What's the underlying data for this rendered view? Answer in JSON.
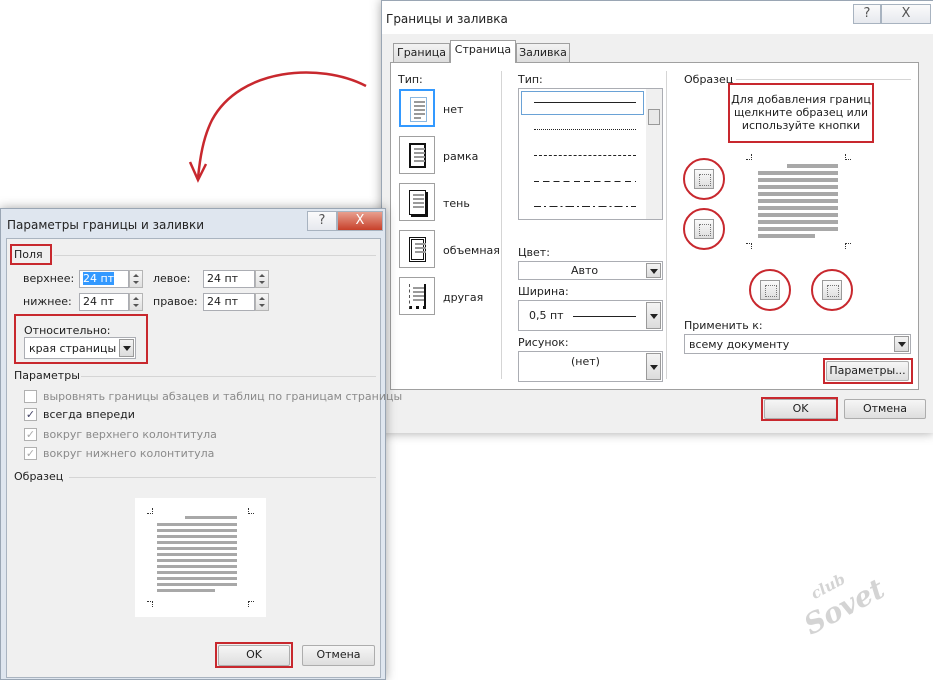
{
  "main_dialog": {
    "title": "Границы и заливка",
    "help_label": "?",
    "close_label": "X",
    "tabs": [
      {
        "label": "Граница",
        "active": false
      },
      {
        "label": "Страница",
        "active": true
      },
      {
        "label": "Заливка",
        "active": false
      }
    ],
    "type_label": "Тип:",
    "types": [
      {
        "label": "нет",
        "selected": true
      },
      {
        "label": "рамка"
      },
      {
        "label": "тень"
      },
      {
        "label": "объемная"
      },
      {
        "label": "другая"
      }
    ],
    "style_label": "Тип:",
    "styles": [
      "solid",
      "dotted",
      "dashed-small",
      "dashed",
      "dash-dot"
    ],
    "color_label": "Цвет:",
    "color_value": "Авто",
    "width_label": "Ширина:",
    "width_value": "0,5 пт",
    "art_label": "Рисунок:",
    "art_value": "(нет)",
    "preview_label": "Образец",
    "preview_hint": "Для добавления границ щелкните образец или используйте кнопки",
    "apply_label": "Применить к:",
    "apply_value": "всему документу",
    "options_button": "Параметры...",
    "ok_button": "OK",
    "cancel_button": "Отмена"
  },
  "options_dialog": {
    "title": "Параметры границы и заливки",
    "help_label": "?",
    "close_label": "X",
    "margins_label": "Поля",
    "top_label": "верхнее:",
    "top_value": "24 пт",
    "left_label": "левое:",
    "left_value": "24 пт",
    "bottom_label": "нижнее:",
    "bottom_value": "24 пт",
    "right_label": "правое:",
    "right_value": "24 пт",
    "relative_label": "Относительно:",
    "relative_value": "края страницы",
    "options_label": "Параметры",
    "checkboxes": [
      {
        "label": "выровнять границы абзацев и таблиц по границам страницы",
        "checked": false,
        "disabled": true
      },
      {
        "label": "всегда впереди",
        "checked": true,
        "disabled": false
      },
      {
        "label": "вокруг верхнего колонтитула",
        "checked": true,
        "disabled": true
      },
      {
        "label": "вокруг нижнего колонтитула",
        "checked": true,
        "disabled": true
      }
    ],
    "preview_label": "Образец",
    "ok_button": "OK",
    "cancel_button": "Отмена"
  },
  "watermark": "club Sovet",
  "colors": {
    "highlight": "#c8282e",
    "accent": "#3399ff"
  }
}
